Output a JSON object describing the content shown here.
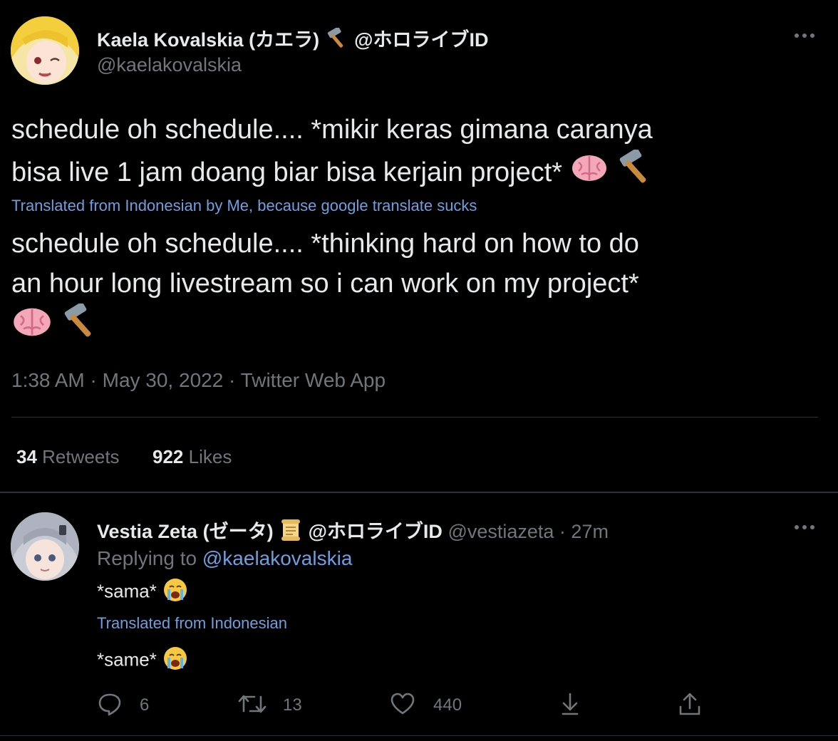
{
  "main_tweet": {
    "display_name": "Kaela Kovalskia (カエラ)",
    "name_suffix": "@ホロライブID",
    "handle": "@kaelakovalskia",
    "text_line1": "schedule oh schedule.... *mikir keras gimana caranya",
    "text_line2": "bisa live 1 jam doang biar bisa kerjain project*",
    "translated_label": "Translated from Indonesian by Me, because google translate sucks",
    "translation_line1": "schedule oh schedule.... *thinking hard on how to do",
    "translation_line2": "an hour long livestream so i can work on my project*",
    "timestamp": "1:38 AM · May 30, 2022 · Twitter Web App",
    "retweets_count": "34",
    "retweets_label": "Retweets",
    "likes_count": "922",
    "likes_label": "Likes"
  },
  "reply_tweet": {
    "display_name": "Vestia Zeta (ゼータ)",
    "name_suffix": "@ホロライブID",
    "handle_time": "@vestiazeta · 27m",
    "replying_prefix": "Replying to",
    "replying_handle": "@kaelakovalskia",
    "text": "*sama*",
    "translated_label": "Translated from Indonesian",
    "translation": "*same*",
    "replies": "6",
    "retweets": "13",
    "likes": "440"
  },
  "icons": {
    "more": "more-icon",
    "hammer": "hammer-icon",
    "brain": "brain-icon",
    "scroll": "scroll-icon",
    "crying": "crying-face-icon",
    "reply": "reply-icon",
    "retweet": "retweet-icon",
    "like": "like-icon",
    "share": "share-icon"
  },
  "colors": {
    "background": "#000000",
    "text": "#e7e9ea",
    "muted": "#71767b",
    "link": "#6e9fe0",
    "divider": "#2f3336"
  }
}
